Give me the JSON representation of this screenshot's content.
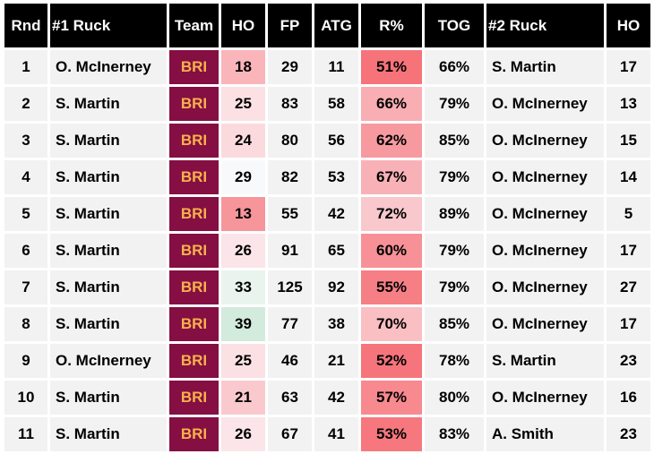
{
  "table": {
    "columns": [
      "Rnd",
      "#1 Ruck",
      "Team",
      "HO",
      "FP",
      "ATG",
      "R%",
      "TOG",
      "#2 Ruck",
      "HO"
    ],
    "rows": [
      {
        "rnd": "1",
        "ruck1": "O. McInerney",
        "team": "BRI",
        "ho": "18",
        "fp": "29",
        "atg": "11",
        "r_pct": "51%",
        "tog": "66%",
        "ruck2": "S. Martin",
        "ho2": "17",
        "ho_color": "#f9b5b9",
        "r_color": "#f6737a"
      },
      {
        "rnd": "2",
        "ruck1": "S. Martin",
        "team": "BRI",
        "ho": "25",
        "fp": "83",
        "atg": "58",
        "r_pct": "66%",
        "tog": "79%",
        "ruck2": "O. McInerney",
        "ho2": "13",
        "ho_color": "#fbe1e4",
        "r_color": "#f8aeb3"
      },
      {
        "rnd": "3",
        "ruck1": "S. Martin",
        "team": "BRI",
        "ho": "24",
        "fp": "80",
        "atg": "56",
        "r_pct": "62%",
        "tog": "85%",
        "ruck2": "O. McInerney",
        "ho2": "15",
        "ho_color": "#fbdadd",
        "r_color": "#f79aa0"
      },
      {
        "rnd": "4",
        "ruck1": "S. Martin",
        "team": "BRI",
        "ho": "29",
        "fp": "82",
        "atg": "53",
        "r_pct": "67%",
        "tog": "79%",
        "ruck2": "O. McInerney",
        "ho2": "14",
        "ho_color": "#f8f9fb",
        "r_color": "#f8b2b7"
      },
      {
        "rnd": "5",
        "ruck1": "S. Martin",
        "team": "BRI",
        "ho": "13",
        "fp": "55",
        "atg": "42",
        "r_pct": "72%",
        "tog": "89%",
        "ruck2": "O. McInerney",
        "ho2": "5",
        "ho_color": "#f6959a",
        "r_color": "#f9c8cc"
      },
      {
        "rnd": "6",
        "ruck1": "S. Martin",
        "team": "BRI",
        "ho": "26",
        "fp": "91",
        "atg": "65",
        "r_pct": "60%",
        "tog": "79%",
        "ruck2": "O. McInerney",
        "ho2": "17",
        "ho_color": "#fbe5e8",
        "r_color": "#f79197"
      },
      {
        "rnd": "7",
        "ruck1": "S. Martin",
        "team": "BRI",
        "ho": "33",
        "fp": "125",
        "atg": "92",
        "r_pct": "55%",
        "tog": "79%",
        "ruck2": "O. McInerney",
        "ho2": "27",
        "ho_color": "#e9f4ee",
        "r_color": "#f67f85"
      },
      {
        "rnd": "8",
        "ruck1": "S. Martin",
        "team": "BRI",
        "ho": "39",
        "fp": "77",
        "atg": "38",
        "r_pct": "70%",
        "tog": "85%",
        "ruck2": "O. McInerney",
        "ho2": "17",
        "ho_color": "#d3ebdc",
        "r_color": "#f9bfc3"
      },
      {
        "rnd": "9",
        "ruck1": "O. McInerney",
        "team": "BRI",
        "ho": "25",
        "fp": "46",
        "atg": "21",
        "r_pct": "52%",
        "tog": "78%",
        "ruck2": "S. Martin",
        "ho2": "23",
        "ho_color": "#fbe1e4",
        "r_color": "#f6747b"
      },
      {
        "rnd": "10",
        "ruck1": "S. Martin",
        "team": "BRI",
        "ho": "21",
        "fp": "63",
        "atg": "42",
        "r_pct": "57%",
        "tog": "80%",
        "ruck2": "O. McInerney",
        "ho2": "16",
        "ho_color": "#fac9cd",
        "r_color": "#f7898f"
      },
      {
        "rnd": "11",
        "ruck1": "S. Martin",
        "team": "BRI",
        "ho": "26",
        "fp": "67",
        "atg": "41",
        "r_pct": "53%",
        "tog": "83%",
        "ruck2": "A. Smith",
        "ho2": "23",
        "ho_color": "#fbe5e8",
        "r_color": "#f6787e"
      }
    ]
  },
  "colors": {
    "header_bg": "#000000",
    "header_text": "#ffffff",
    "cell_bg": "#f2f2f2",
    "team_bg": "#850e43",
    "team_text": "#f6b24b"
  }
}
